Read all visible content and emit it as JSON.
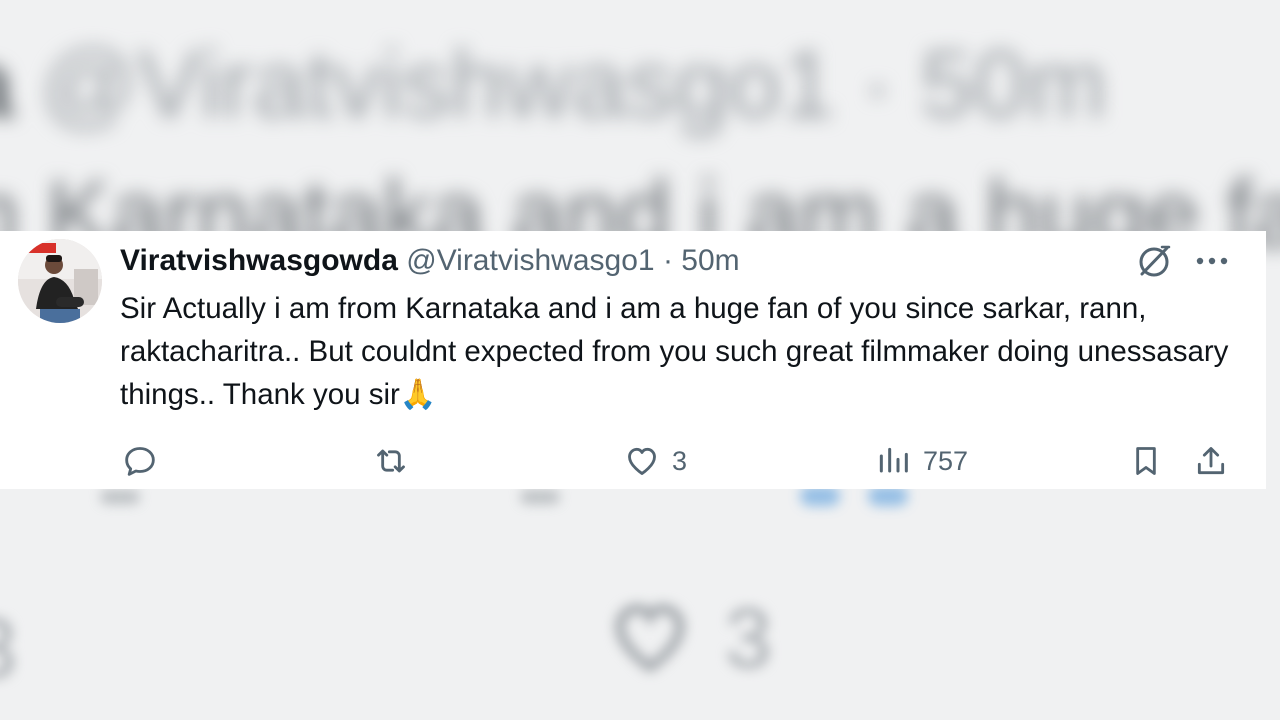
{
  "tweet": {
    "display_name": "Viratvishwasgowda",
    "handle": "@Viratvishwasgo1",
    "separator": "·",
    "time": "50m",
    "text": "Sir Actually i am from Karnataka and i am a huge fan of you since sarkar, rann, raktacharitra.. But couldnt expected from you such great filmmaker doing unessasary things.. Thank you sir🙏",
    "likes": "3",
    "views": "757"
  },
  "background": {
    "line1_name": "a",
    "line1_rest": " @Viratvishwasgo1 · 50m",
    "line2": "m Karnataka and i am a huge fan",
    "likes": "3",
    "edge_number": "3"
  },
  "icons": {
    "grok": "grok-icon",
    "more": "more-icon",
    "reply": "reply-icon",
    "retweet": "retweet-icon",
    "like": "heart-icon",
    "views": "views-icon",
    "bookmark": "bookmark-icon",
    "share": "share-icon"
  },
  "colors": {
    "text_primary": "#0f1419",
    "text_secondary": "#536471",
    "background_blur": "#f0f1f2"
  }
}
